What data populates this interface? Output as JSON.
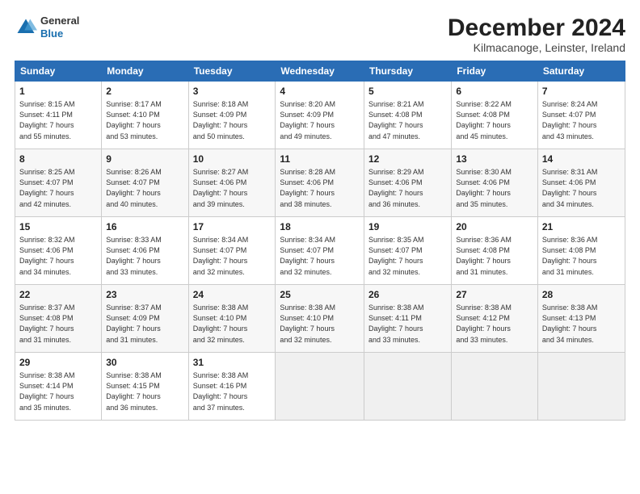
{
  "header": {
    "logo_line1": "General",
    "logo_line2": "Blue",
    "title": "December 2024",
    "subtitle": "Kilmacanoge, Leinster, Ireland"
  },
  "calendar": {
    "headers": [
      "Sunday",
      "Monday",
      "Tuesday",
      "Wednesday",
      "Thursday",
      "Friday",
      "Saturday"
    ],
    "weeks": [
      [
        {
          "day": "",
          "info": ""
        },
        {
          "day": "2",
          "info": "Sunrise: 8:17 AM\nSunset: 4:10 PM\nDaylight: 7 hours\nand 53 minutes."
        },
        {
          "day": "3",
          "info": "Sunrise: 8:18 AM\nSunset: 4:09 PM\nDaylight: 7 hours\nand 50 minutes."
        },
        {
          "day": "4",
          "info": "Sunrise: 8:20 AM\nSunset: 4:09 PM\nDaylight: 7 hours\nand 49 minutes."
        },
        {
          "day": "5",
          "info": "Sunrise: 8:21 AM\nSunset: 4:08 PM\nDaylight: 7 hours\nand 47 minutes."
        },
        {
          "day": "6",
          "info": "Sunrise: 8:22 AM\nSunset: 4:08 PM\nDaylight: 7 hours\nand 45 minutes."
        },
        {
          "day": "7",
          "info": "Sunrise: 8:24 AM\nSunset: 4:07 PM\nDaylight: 7 hours\nand 43 minutes."
        }
      ],
      [
        {
          "day": "8",
          "info": "Sunrise: 8:25 AM\nSunset: 4:07 PM\nDaylight: 7 hours\nand 42 minutes."
        },
        {
          "day": "9",
          "info": "Sunrise: 8:26 AM\nSunset: 4:07 PM\nDaylight: 7 hours\nand 40 minutes."
        },
        {
          "day": "10",
          "info": "Sunrise: 8:27 AM\nSunset: 4:06 PM\nDaylight: 7 hours\nand 39 minutes."
        },
        {
          "day": "11",
          "info": "Sunrise: 8:28 AM\nSunset: 4:06 PM\nDaylight: 7 hours\nand 38 minutes."
        },
        {
          "day": "12",
          "info": "Sunrise: 8:29 AM\nSunset: 4:06 PM\nDaylight: 7 hours\nand 36 minutes."
        },
        {
          "day": "13",
          "info": "Sunrise: 8:30 AM\nSunset: 4:06 PM\nDaylight: 7 hours\nand 35 minutes."
        },
        {
          "day": "14",
          "info": "Sunrise: 8:31 AM\nSunset: 4:06 PM\nDaylight: 7 hours\nand 34 minutes."
        }
      ],
      [
        {
          "day": "15",
          "info": "Sunrise: 8:32 AM\nSunset: 4:06 PM\nDaylight: 7 hours\nand 34 minutes."
        },
        {
          "day": "16",
          "info": "Sunrise: 8:33 AM\nSunset: 4:06 PM\nDaylight: 7 hours\nand 33 minutes."
        },
        {
          "day": "17",
          "info": "Sunrise: 8:34 AM\nSunset: 4:07 PM\nDaylight: 7 hours\nand 32 minutes."
        },
        {
          "day": "18",
          "info": "Sunrise: 8:34 AM\nSunset: 4:07 PM\nDaylight: 7 hours\nand 32 minutes."
        },
        {
          "day": "19",
          "info": "Sunrise: 8:35 AM\nSunset: 4:07 PM\nDaylight: 7 hours\nand 32 minutes."
        },
        {
          "day": "20",
          "info": "Sunrise: 8:36 AM\nSunset: 4:08 PM\nDaylight: 7 hours\nand 31 minutes."
        },
        {
          "day": "21",
          "info": "Sunrise: 8:36 AM\nSunset: 4:08 PM\nDaylight: 7 hours\nand 31 minutes."
        }
      ],
      [
        {
          "day": "22",
          "info": "Sunrise: 8:37 AM\nSunset: 4:08 PM\nDaylight: 7 hours\nand 31 minutes."
        },
        {
          "day": "23",
          "info": "Sunrise: 8:37 AM\nSunset: 4:09 PM\nDaylight: 7 hours\nand 31 minutes."
        },
        {
          "day": "24",
          "info": "Sunrise: 8:38 AM\nSunset: 4:10 PM\nDaylight: 7 hours\nand 32 minutes."
        },
        {
          "day": "25",
          "info": "Sunrise: 8:38 AM\nSunset: 4:10 PM\nDaylight: 7 hours\nand 32 minutes."
        },
        {
          "day": "26",
          "info": "Sunrise: 8:38 AM\nSunset: 4:11 PM\nDaylight: 7 hours\nand 33 minutes."
        },
        {
          "day": "27",
          "info": "Sunrise: 8:38 AM\nSunset: 4:12 PM\nDaylight: 7 hours\nand 33 minutes."
        },
        {
          "day": "28",
          "info": "Sunrise: 8:38 AM\nSunset: 4:13 PM\nDaylight: 7 hours\nand 34 minutes."
        }
      ],
      [
        {
          "day": "29",
          "info": "Sunrise: 8:38 AM\nSunset: 4:14 PM\nDaylight: 7 hours\nand 35 minutes."
        },
        {
          "day": "30",
          "info": "Sunrise: 8:38 AM\nSunset: 4:15 PM\nDaylight: 7 hours\nand 36 minutes."
        },
        {
          "day": "31",
          "info": "Sunrise: 8:38 AM\nSunset: 4:16 PM\nDaylight: 7 hours\nand 37 minutes."
        },
        {
          "day": "",
          "info": ""
        },
        {
          "day": "",
          "info": ""
        },
        {
          "day": "",
          "info": ""
        },
        {
          "day": "",
          "info": ""
        }
      ]
    ],
    "week1_day1": {
      "day": "1",
      "info": "Sunrise: 8:15 AM\nSunset: 4:11 PM\nDaylight: 7 hours\nand 55 minutes."
    }
  }
}
